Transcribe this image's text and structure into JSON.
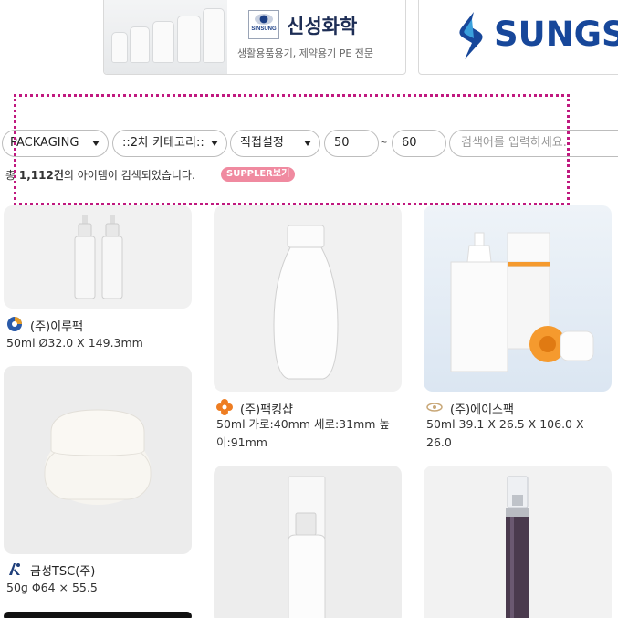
{
  "banners": [
    {
      "title": "신성화학",
      "subtitle": "생활용품용기, 제약용기 PE 전문",
      "logo_text": "SINSUNG"
    },
    {
      "title": "SUNGS"
    }
  ],
  "filters": {
    "category1": "PACKAGING",
    "category2": "::2차 카테고리::",
    "range_mode": "직접설정",
    "min": "50",
    "max": "60",
    "range_sep": "~",
    "search_placeholder": "검색어를 입력하세요."
  },
  "results": {
    "prefix": "총 ",
    "count": "1,112건",
    "suffix": "의 아이템이 검색되었습니다.",
    "supplier_button": "SUPPLER보기"
  },
  "products": [
    {
      "seller": "(주)이루팩",
      "spec": "50ml Ø32.0 X 149.3mm"
    },
    {
      "seller": "(주)팩킹샵",
      "spec": "50ml 가로:40mm 세로:31mm 높이:91mm"
    },
    {
      "seller": "(주)에이스팩",
      "spec": "50ml 39.1 X 26.5 X 106.0 X 26.0"
    },
    {
      "seller": "금성TSC(주)",
      "spec": "50g Φ64 × 55.5"
    }
  ],
  "colors": {
    "highlight_border": "#c0197f",
    "supplier_badge": "#f08aa0",
    "brand_blue": "#17479a"
  }
}
